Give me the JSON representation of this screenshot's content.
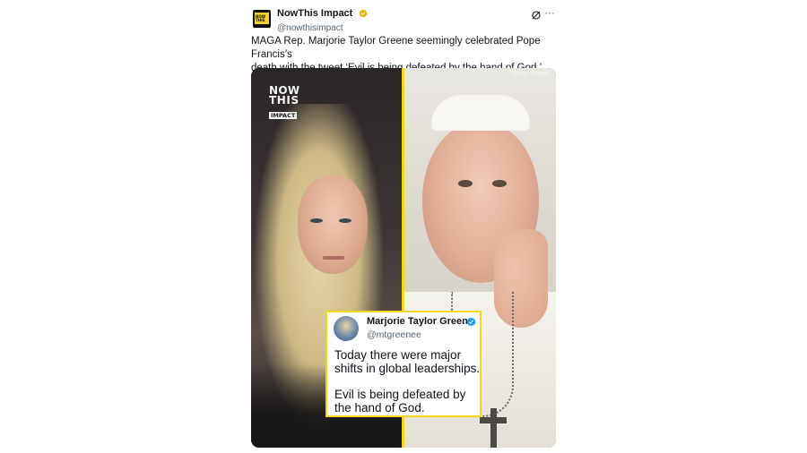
{
  "tweet": {
    "author": {
      "display_name": "NowThis Impact",
      "handle": "@nowthisimpact",
      "verified": "gold"
    },
    "actions": {
      "grok_icon": "grok-icon",
      "more_icon": "more-icon",
      "more_label": "···"
    },
    "text_line1": "MAGA Rep. Marjorie Taylor Greene seemingly celebrated Pope Francis’s",
    "text_line2": "death with the tweet ‘Evil is being defeated by the hand of God.’",
    "media": {
      "credit": "Getty Images",
      "logo": {
        "now": "NOW",
        "this": "THIS",
        "impact": "IMPACT"
      },
      "divider_color": "#f5d81e",
      "embedded_tweet": {
        "display_name": "Marjorie Taylor Green",
        "handle": "@mtgreenee",
        "verified": "blue",
        "lines": [
          "Today there were major",
          "shifts in global leaderships.",
          "Evil is being defeated by",
          "the hand of God."
        ]
      }
    }
  },
  "colors": {
    "gold_check": "#e2b719",
    "blue_check": "#1d9bf0",
    "handle_gray": "#536471",
    "text": "#0f1419"
  }
}
